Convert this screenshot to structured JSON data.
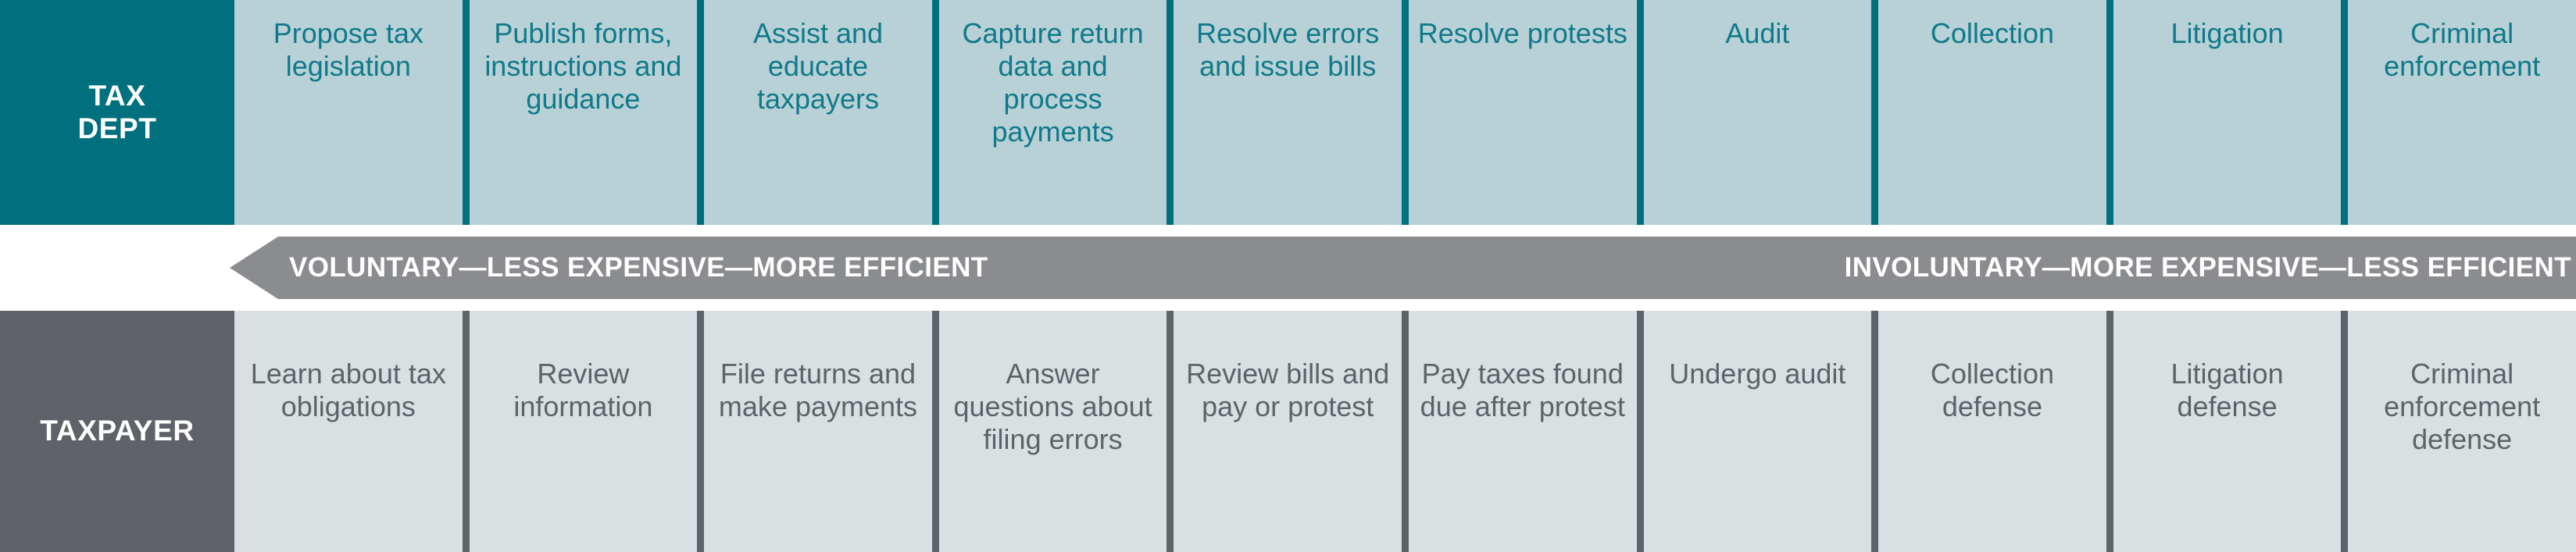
{
  "colors": {
    "tax_dept_header": "#00707f",
    "tax_dept_cell": "#b7d1d6",
    "tax_dept_text": "#10798a",
    "taxpayer_header": "#5f6268",
    "taxpayer_cell": "#d8e0e2",
    "taxpayer_text": "#5f6268",
    "arrow_band": "#8a8c8f",
    "label_text": "#ffffff",
    "background": "#ffffff"
  },
  "rows": {
    "tax_dept": {
      "label": "TAX\nDEPT",
      "label_line1": "TAX",
      "label_line2": "DEPT",
      "cells": [
        "Propose tax legislation",
        "Publish forms, instructions and guidance",
        "Assist and educate taxpayers",
        "Capture return data and process payments",
        "Resolve errors and issue bills",
        "Resolve protests",
        "Audit",
        "Collection",
        "Litigation",
        "Criminal enforcement"
      ]
    },
    "taxpayer": {
      "label": "TAXPAYER",
      "cells": [
        "Learn about tax obligations",
        "Review information",
        "File returns and make payments",
        "Answer questions about filing errors",
        "Review bills and pay or protest",
        "Pay taxes found due after protest",
        "Undergo audit",
        "Collection defense",
        "Litigation defense",
        "Criminal enforcement defense"
      ]
    }
  },
  "arrow_banner": {
    "direction": "left",
    "left_label": "VOLUNTARY—LESS EXPENSIVE—MORE EFFICIENT",
    "right_label": "INVOLUNTARY—MORE EXPENSIVE—LESS EFFICIENT"
  }
}
